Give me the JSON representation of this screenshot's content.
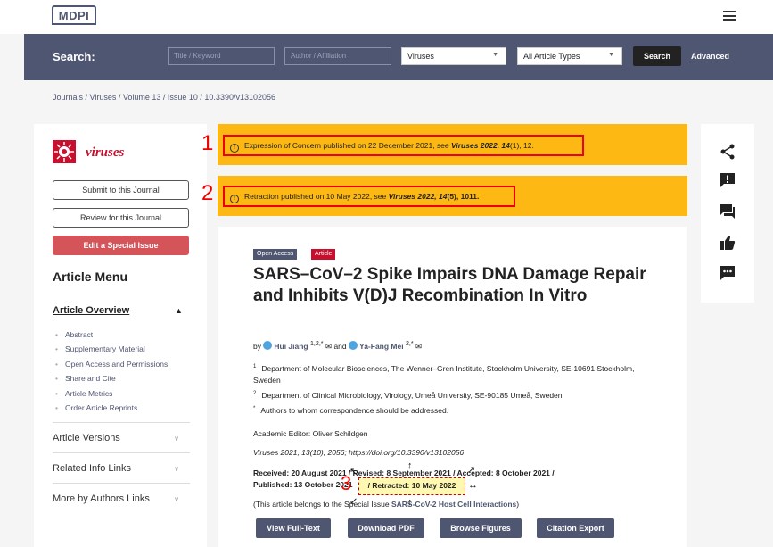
{
  "header": {
    "logo": "MDPI"
  },
  "search": {
    "label": "Search:",
    "title_placeholder": "Title / Keyword",
    "author_placeholder": "Author / Affiliation",
    "journal_select": "Viruses",
    "type_select": "All Article Types",
    "search_button": "Search",
    "advanced_link": "Advanced"
  },
  "breadcrumb": "Journals / Viruses / Volume 13 / Issue 10 / 10.3390/v13102056",
  "sidebar": {
    "journal_name": "viruses",
    "submit": "Submit to this Journal",
    "review": "Review for this Journal",
    "edit_special": "Edit a Special Issue",
    "menu_title": "Article Menu",
    "overview": "Article Overview",
    "items": [
      "Abstract",
      "Supplementary Material",
      "Open Access and Permissions",
      "Share and Cite",
      "Article Metrics",
      "Order Article Reprints"
    ],
    "sections": [
      "Article Versions",
      "Related Info Links",
      "More by Authors Links"
    ]
  },
  "notices": {
    "n1_marker": "1",
    "n1_text": "Expression of Concern published on 22 December 2021, see",
    "n1_ref": "Viruses 2022, 14",
    "n1_tail": "(1), 12.",
    "n2_marker": "2",
    "n2_text": "Retraction published on 10 May 2022, see",
    "n2_ref": "Viruses 2022, 14",
    "n2_tail": "(5), 1011."
  },
  "article": {
    "badge_open": "Open Access",
    "badge_type": "Article",
    "title": "SARS–CoV–2 Spike Impairs DNA Damage Repair and Inhibits V(D)J Recombination In Vitro",
    "by": "by",
    "author1": "Hui Jiang",
    "author1_sup": "1,2,*",
    "and": "and",
    "author2": "Ya-Fang Mei",
    "author2_sup": "2,*",
    "affil1_num": "1",
    "affil1": "Department of Molecular Biosciences, The Wenner–Gren Institute, Stockholm University, SE-10691 Stockholm, Sweden",
    "affil2_num": "2",
    "affil2": "Department of Clinical Microbiology, Virology, Umeå University, SE-90185 Umeå, Sweden",
    "affil3_num": "*",
    "affil3": "Authors to whom correspondence should be addressed.",
    "editor": "Academic Editor: Oliver Schildgen",
    "citation": "Viruses 2021, 13(10), 2056; https://doi.org/10.3390/v13102056",
    "dates": "Received: 20 August 2021 / Revised: 8 September 2021 / Accepted: 8 October 2021 / Published: 13 October 2021",
    "marker3": "3",
    "retracted": "/ Retracted: 10 May 2022",
    "belongs_prefix": "(This article belongs to the Special Issue",
    "belongs_issue": "SARS-CoV-2 Host Cell Interactions",
    "belongs_suffix": ")",
    "btn_fulltext": "View Full-Text",
    "btn_pdf": "Download PDF",
    "btn_figures": "Browse Figures",
    "btn_export": "Citation Export"
  },
  "colors": {
    "accent": "#4f5671",
    "notice": "#fdb813",
    "journal_red": "#c8102e",
    "marker_red": "#e00000"
  },
  "rail_icons": [
    "share-icon",
    "report-icon",
    "comment-icon",
    "thumbs-up-icon",
    "more-icon"
  ]
}
